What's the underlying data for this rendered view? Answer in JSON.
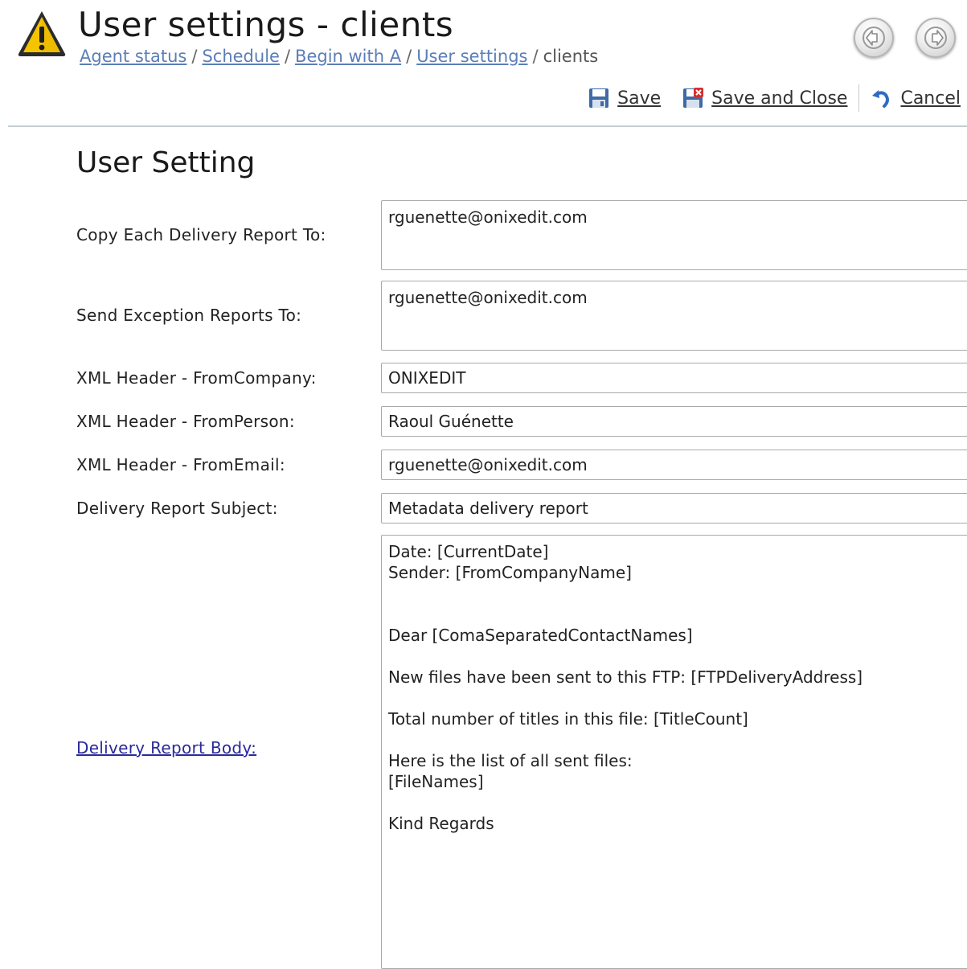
{
  "header": {
    "title": "User settings - clients",
    "breadcrumb": {
      "items": [
        "Agent status",
        "Schedule",
        "Begin with A",
        "User settings"
      ],
      "separator": "/",
      "current": "clients"
    }
  },
  "nav": {
    "back_icon": "arrow-left-icon",
    "forward_icon": "arrow-right-icon"
  },
  "toolbar": {
    "save_label": "Save",
    "save_close_label": "Save and Close",
    "cancel_label": "Cancel"
  },
  "form": {
    "section_title": "User Setting",
    "copy_report_label": "Copy Each Delivery Report To:",
    "copy_report_value": "rguenette@onixedit.com",
    "exception_label": "Send Exception Reports To:",
    "exception_value": "rguenette@onixedit.com",
    "from_company_label": "XML Header - FromCompany:",
    "from_company_value": "ONIXEDIT",
    "from_person_label": "XML Header - FromPerson:",
    "from_person_value": "Raoul Guénette",
    "from_email_label": "XML Header - FromEmail:",
    "from_email_value": "rguenette@onixedit.com",
    "subject_label": "Delivery Report Subject:",
    "subject_value": "Metadata delivery report",
    "body_label": "Delivery Report Body:",
    "body_value": "Date: [CurrentDate]\nSender: [FromCompanyName]\n\n\nDear [ComaSeparatedContactNames]\n\nNew files have been sent to this FTP: [FTPDeliveryAddress]\n\nTotal number of titles in this file: [TitleCount]\n\nHere is the list of all sent files:\n[FileNames]\n\nKind Regards"
  },
  "colors": {
    "link": "#5b7eb6",
    "body_link": "#2a2a9a",
    "warning": "#f5c400",
    "divider": "#c4cdd3"
  }
}
